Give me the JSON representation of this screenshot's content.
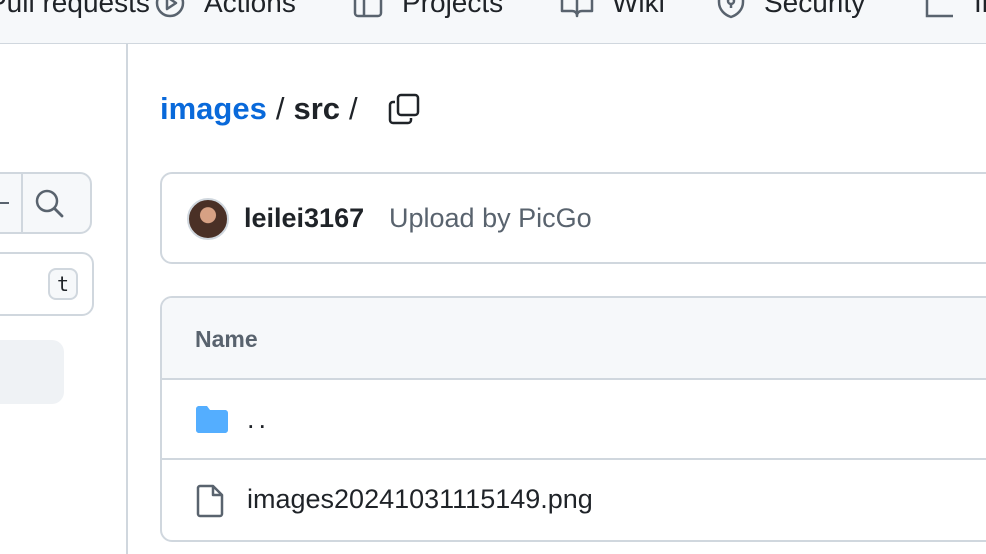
{
  "top_nav": {
    "items": [
      {
        "label": "Pull requests",
        "icon": "pull-request-icon"
      },
      {
        "label": "Actions",
        "icon": "actions-play-icon"
      },
      {
        "label": "Projects",
        "icon": "table-icon"
      },
      {
        "label": "Wiki",
        "icon": "book-icon"
      },
      {
        "label": "Security",
        "icon": "shield-icon"
      },
      {
        "label": "Insights",
        "icon": "graph-icon"
      }
    ]
  },
  "sidebar": {
    "search_icon": "search-icon",
    "go_to_file_shortcut": "t"
  },
  "breadcrumb": {
    "repo": "images",
    "separator": "/",
    "current": "src",
    "copy_icon": "copy-icon"
  },
  "latest_commit": {
    "author": "leilei3167",
    "message": "Upload by PicGo"
  },
  "file_table": {
    "column_name": "Name",
    "rows": [
      {
        "name": "..",
        "icon": "folder-icon"
      },
      {
        "name": "images20241031115149.png",
        "icon": "file-icon"
      }
    ]
  },
  "colors": {
    "link": "#0969da",
    "folder": "#54aeff",
    "border": "#d0d7de",
    "muted_text": "#59636e",
    "header_bg": "#f6f8fa"
  }
}
